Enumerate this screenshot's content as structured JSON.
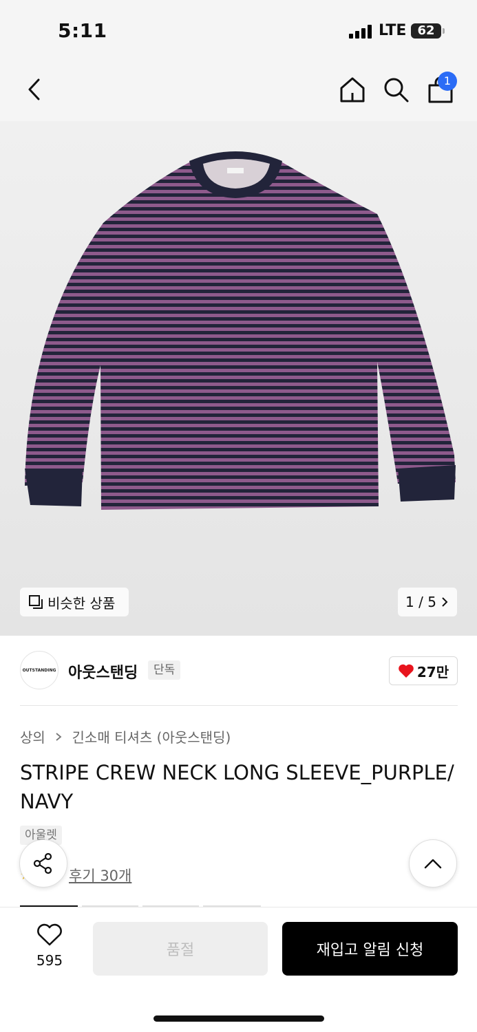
{
  "status_bar": {
    "time": "5:11",
    "network": "LTE",
    "battery": "62"
  },
  "nav": {
    "cart_count": "1"
  },
  "gallery": {
    "similar_label": "비슷한 상품",
    "page_indicator": "1 / 5"
  },
  "brand": {
    "logo_text": "OUTSTANDING",
    "name": "아웃스탠딩",
    "tag": "단독",
    "likes": "27만"
  },
  "product": {
    "breadcrumb_parent": "상의",
    "breadcrumb_child": "긴소매 티셔츠 (아웃스탠딩)",
    "title": "STRIPE CREW NECK LONG SLEEVE_PURPLE/NAVY",
    "outlet_tag": "아울렛",
    "review_link": "후기 30개"
  },
  "bottom_bar": {
    "wish_count": "595",
    "soldout_label": "품절",
    "restock_label": "재입고 알림 신청"
  },
  "colors": {
    "accent_blue": "#2b6cf6",
    "heart_red": "#e8141d",
    "stripe_purple": "#8e5a8c",
    "stripe_navy": "#22243a"
  }
}
